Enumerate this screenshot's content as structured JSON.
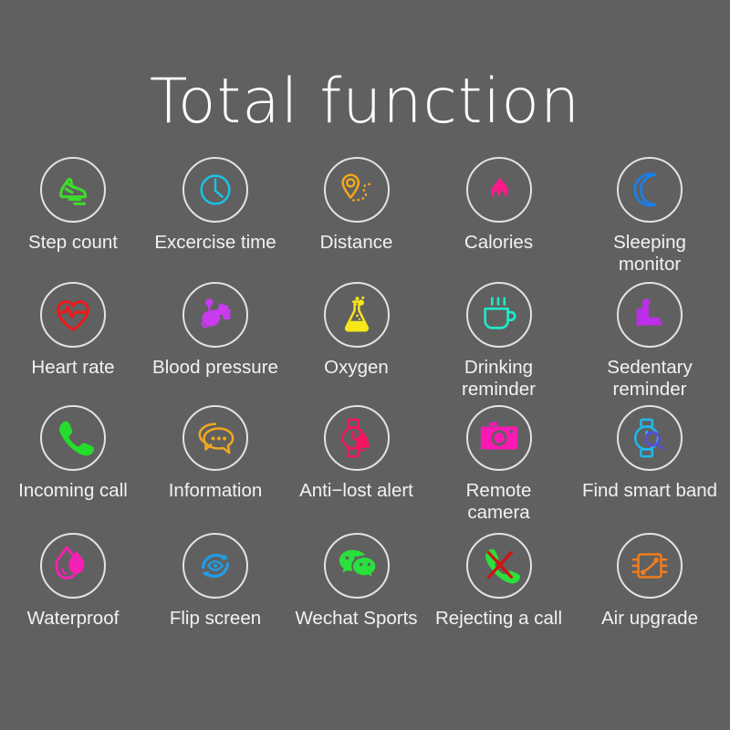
{
  "page": {
    "title": "Total function",
    "background_color": "#606060",
    "title_color": "#fdfdfd",
    "label_color": "#f2f2f2",
    "ring_color": "#e3e3e3"
  },
  "grid": {
    "columns": 5,
    "rows": 4,
    "features": [
      {
        "label": "Step count",
        "icon": "running-shoe-icon",
        "color": "#3ddc2a"
      },
      {
        "label": "Excercise time",
        "icon": "clock-icon",
        "color": "#18c3e8"
      },
      {
        "label": "Distance",
        "icon": "map-pin-route-icon",
        "color": "#f4a81d"
      },
      {
        "label": "Calories",
        "icon": "flame-icon",
        "color": "#fc1a8a"
      },
      {
        "label": "Sleeping\nmonitor",
        "icon": "crescent-moon-icon",
        "color": "#1a7fe8"
      },
      {
        "label": "Heart rate",
        "icon": "heart-pulse-icon",
        "color": "#f41616"
      },
      {
        "label": "Blood pressure",
        "icon": "blood-pressure-icon",
        "color": "#c83bf0"
      },
      {
        "label": "Oxygen",
        "icon": "flask-bubbles-icon",
        "color": "#f5e71a"
      },
      {
        "label": "Drinking reminder",
        "icon": "coffee-cup-icon",
        "color": "#1fe8c8"
      },
      {
        "label": "Sedentary\nreminder",
        "icon": "seated-person-icon",
        "color": "#bd2ee8"
      },
      {
        "label": "Incoming call",
        "icon": "phone-handset-icon",
        "color": "#24dd2c"
      },
      {
        "label": "Information",
        "icon": "chat-bubbles-icon",
        "color": "#f0a81e"
      },
      {
        "label": "Anti−lost alert",
        "icon": "watch-bell-icon",
        "color": "#f5155f"
      },
      {
        "label": "Remote\ncamera",
        "icon": "camera-icon",
        "color": "#fb18b4"
      },
      {
        "label": "Find smart band",
        "icon": "watch-search-icon",
        "color": "#1fb9ec"
      },
      {
        "label": "Waterproof",
        "icon": "water-drop-icon",
        "color": "#f520b4"
      },
      {
        "label": "Flip screen",
        "icon": "flip-screen-eye-icon",
        "color": "#1f9de8"
      },
      {
        "label": "Wechat Sports",
        "icon": "wechat-bubbles-icon",
        "color": "#2ae03c"
      },
      {
        "label": "Rejecting a call",
        "icon": "reject-call-icon",
        "color": "#2ae03c"
      },
      {
        "label": "Air upgrade",
        "icon": "chip-upgrade-icon",
        "color": "#f07d1e"
      }
    ]
  }
}
